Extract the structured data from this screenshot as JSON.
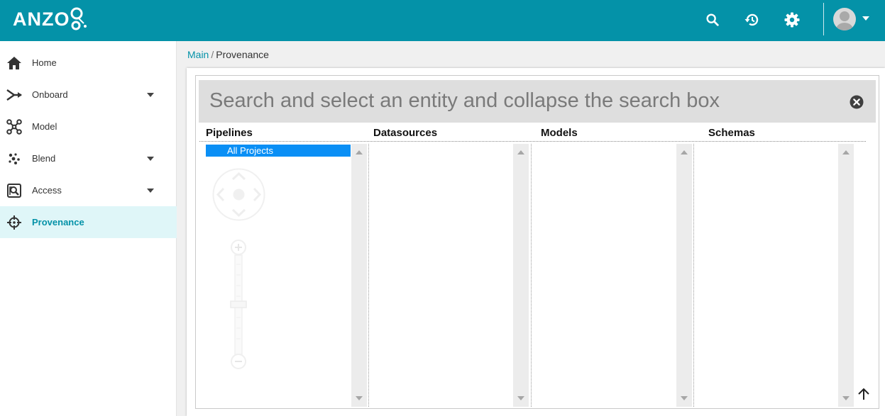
{
  "app": {
    "logo_text": "ANZO",
    "accent_color": "#0492a8"
  },
  "toolbar": {
    "icons": [
      "search-icon",
      "history-icon",
      "gear-icon",
      "avatar-icon",
      "caret-down-icon"
    ]
  },
  "sidebar": {
    "items": [
      {
        "label": "Home",
        "icon": "home-icon",
        "expandable": false,
        "active": false
      },
      {
        "label": "Onboard",
        "icon": "onboard-icon",
        "expandable": true,
        "active": false
      },
      {
        "label": "Model",
        "icon": "model-icon",
        "expandable": false,
        "active": false
      },
      {
        "label": "Blend",
        "icon": "blend-icon",
        "expandable": true,
        "active": false
      },
      {
        "label": "Access",
        "icon": "access-icon",
        "expandable": true,
        "active": false
      },
      {
        "label": "Provenance",
        "icon": "crosshair-icon",
        "expandable": false,
        "active": true
      }
    ]
  },
  "breadcrumb": {
    "root": "Main",
    "separator": "/",
    "current": "Provenance"
  },
  "search": {
    "placeholder": "Search and select an entity and collapse the search box"
  },
  "columns": [
    {
      "header": "Pipelines",
      "items": [
        "All Projects"
      ],
      "selected": "All Projects"
    },
    {
      "header": "Datasources",
      "items": []
    },
    {
      "header": "Models",
      "items": []
    },
    {
      "header": "Schemas",
      "items": []
    }
  ],
  "colors": {
    "selection": "#0a8ff5",
    "active_nav_bg": "#dff6f8"
  }
}
